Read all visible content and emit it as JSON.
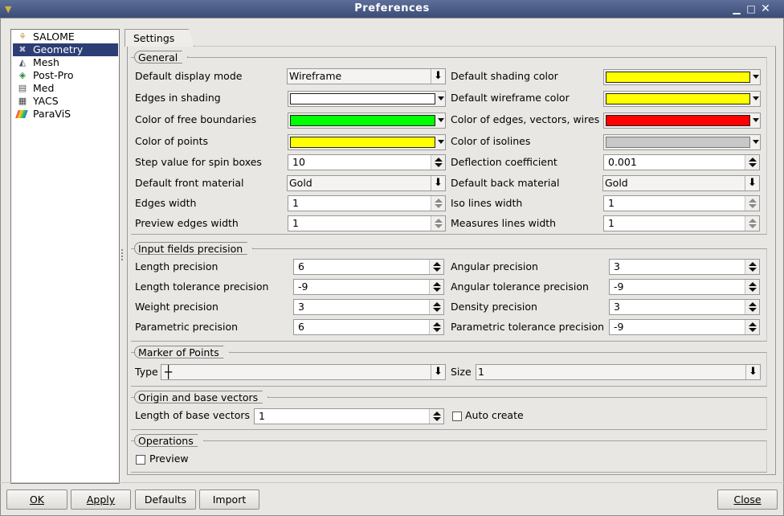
{
  "window": {
    "title": "Preferences"
  },
  "sidebar": {
    "items": [
      {
        "label": "SALOME",
        "icon": "salome-icon"
      },
      {
        "label": "Geometry",
        "icon": "geometry-icon"
      },
      {
        "label": "Mesh",
        "icon": "mesh-icon"
      },
      {
        "label": "Post-Pro",
        "icon": "post-pro-icon"
      },
      {
        "label": "Med",
        "icon": "med-icon"
      },
      {
        "label": "YACS",
        "icon": "yacs-icon"
      },
      {
        "label": "ParaViS",
        "icon": "paravis-icon"
      }
    ],
    "selected": "Geometry"
  },
  "tab": {
    "label": "Settings"
  },
  "general": {
    "title": "General",
    "default_display_mode": {
      "label": "Default display mode",
      "value": "Wireframe"
    },
    "edges_in_shading": {
      "label": "Edges in shading",
      "color": "#ffffff"
    },
    "color_free_boundaries": {
      "label": "Color of free boundaries",
      "color": "#00ff00"
    },
    "color_points": {
      "label": "Color of points",
      "color": "#ffff00"
    },
    "step_value": {
      "label": "Step value for spin boxes",
      "value": "10"
    },
    "front_material": {
      "label": "Default front material",
      "value": "Gold"
    },
    "edges_width": {
      "label": "Edges width",
      "value": "1"
    },
    "preview_edges_width": {
      "label": "Preview edges width",
      "value": "1"
    },
    "shading_color": {
      "label": "Default shading color",
      "color": "#ffff00"
    },
    "wireframe_color": {
      "label": "Default wireframe color",
      "color": "#ffff00"
    },
    "edges_vectors_color": {
      "label": "Color of edges, vectors, wires",
      "color": "#ff0000"
    },
    "isolines_color": {
      "label": "Color of isolines",
      "color": "#c8c8c8"
    },
    "deflection": {
      "label": "Deflection coefficient",
      "value": "0.001"
    },
    "back_material": {
      "label": "Default back material",
      "value": "Gold"
    },
    "iso_lines_width": {
      "label": "Iso lines width",
      "value": "1"
    },
    "measures_lines_width": {
      "label": "Measures lines width",
      "value": "1"
    }
  },
  "precision": {
    "title": "Input fields precision",
    "length": {
      "label": "Length precision",
      "value": "6"
    },
    "length_tol": {
      "label": "Length tolerance precision",
      "value": "-9"
    },
    "weight": {
      "label": "Weight precision",
      "value": "3"
    },
    "parametric": {
      "label": "Parametric precision",
      "value": "6"
    },
    "angular": {
      "label": "Angular precision",
      "value": "3"
    },
    "angular_tol": {
      "label": "Angular tolerance precision",
      "value": "-9"
    },
    "density": {
      "label": "Density precision",
      "value": "3"
    },
    "parametric_tol": {
      "label": "Parametric tolerance precision",
      "value": "-9"
    }
  },
  "marker": {
    "title": "Marker of Points",
    "type_label": "Type",
    "type_value": "┼",
    "size_label": "Size",
    "size_value": "1"
  },
  "origin": {
    "title": "Origin and base vectors",
    "length_label": "Length of base vectors",
    "length_value": "1",
    "auto_create_label": "Auto create",
    "auto_create_checked": false
  },
  "operations": {
    "title": "Operations",
    "preview_label": "Preview",
    "preview_checked": false
  },
  "buttons": {
    "ok": "OK",
    "apply": "Apply",
    "defaults": "Defaults",
    "import": "Import",
    "close": "Close"
  }
}
